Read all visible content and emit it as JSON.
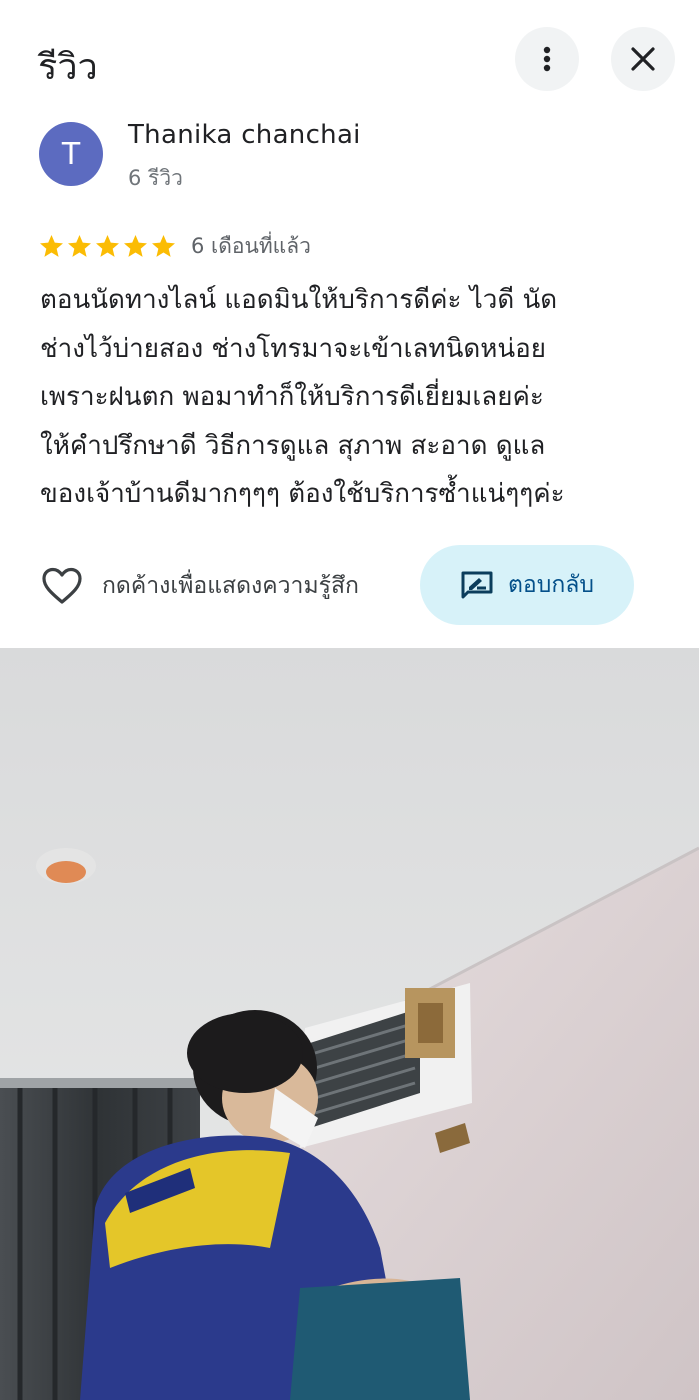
{
  "header": {
    "title": "รีวิว",
    "more_icon": "more-vert-icon",
    "close_icon": "close-icon"
  },
  "reviewer": {
    "avatar_letter": "T",
    "avatar_color": "#5c6bc0",
    "name": "Thanika chanchai",
    "review_count": "6 รีวิว"
  },
  "review": {
    "rating": 5,
    "max_rating": 5,
    "star_color": "#fbbc04",
    "time_ago": "6 เดือนที่แล้ว",
    "lines": [
      "ตอนนัดทางไลน์ แอดมินให้บริการดีค่ะ ไวดี นัด",
      "ช่างไว้บ่ายสอง ช่างโทรมาจะเข้าเลทนิดหน่อย",
      "เพราะฝนตก พอมาทำก็ให้บริการดีเยี่ยมเลยค่ะ",
      "ให้คำปรึกษาดี วิธีการดูแล สุภาพ สะอาด ดูแล",
      "ของเจ้าบ้านดีมากๆๆๆ ต้องใช้บริการซ้ำแน่ๆๆค่ะ"
    ]
  },
  "actions": {
    "like_label": "กดค้างเพื่อแสดงความรู้สึก",
    "reply_label": "ตอบกลับ",
    "reply_bg": "#d7f2f9"
  },
  "photo": {
    "description_icon": "review-photo"
  }
}
